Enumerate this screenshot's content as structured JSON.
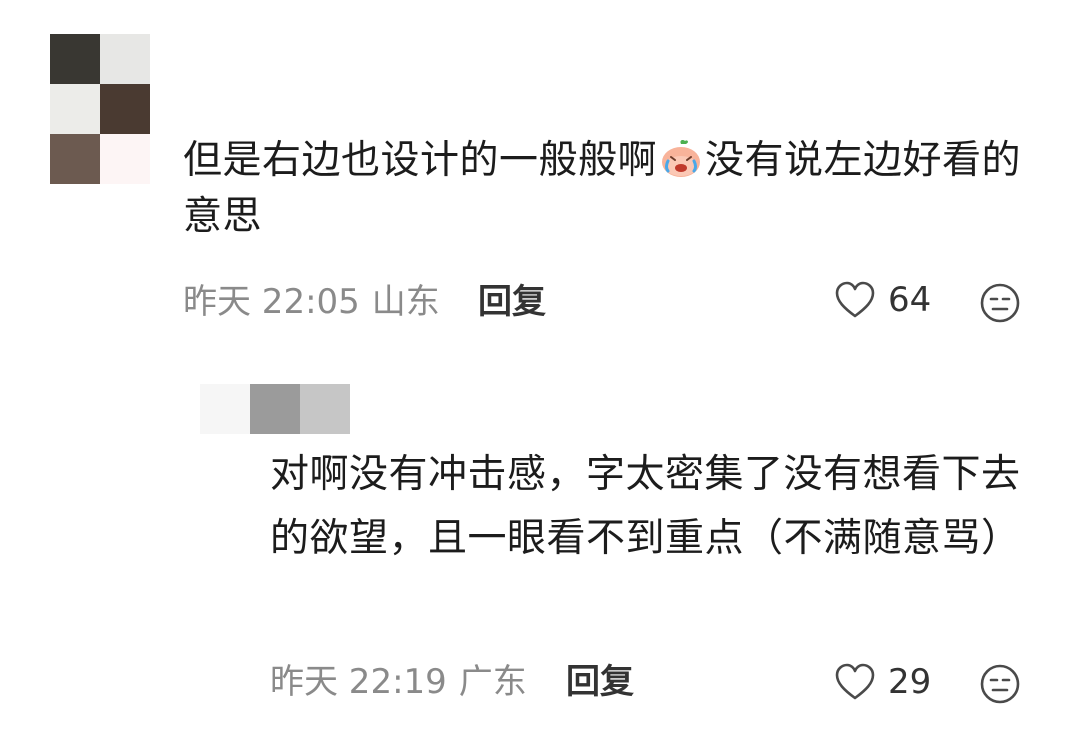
{
  "comments": [
    {
      "avatar_colors": [
        "#393732",
        "#e7e7e5",
        "#ecece9",
        "#4a3a31",
        "#6c5a50",
        "#fdf5f5"
      ],
      "text_before_emoji": "但是右边也设计的一般般啊",
      "emoji_icon": "crying-laughing-peach-emoji",
      "text_after_emoji": "没有说左边好看的意思",
      "time": "昨天 22:05",
      "location": "山东",
      "reply_label": "回复",
      "likes": "64"
    },
    {
      "avatar_colors": [
        "#9b9b9b",
        "#c6c6c6"
      ],
      "text": "对啊没有冲击感，字太密集了没有想看下去的欲望，且一眼看不到重点（不满随意骂）",
      "time": "昨天 22:19",
      "location": "广东",
      "reply_label": "回复",
      "likes": "29"
    }
  ],
  "icons": {
    "like": "heart-outline-icon",
    "dislike": "neutral-face-icon"
  },
  "colors": {
    "meta_gray": "#8a8a8a",
    "text_dark": "#1c1c1c",
    "action_dark": "#333333"
  }
}
